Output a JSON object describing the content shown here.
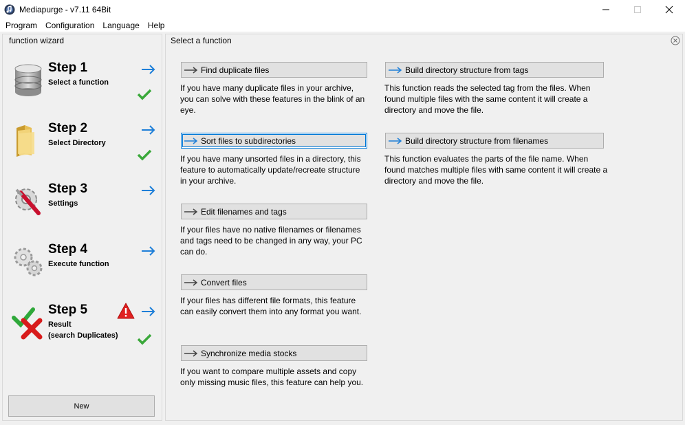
{
  "window": {
    "title": "Mediapurge - v7.11 64Bit",
    "controls": [
      "minimize",
      "maximize",
      "close"
    ]
  },
  "menu": [
    "Program",
    "Configuration",
    "Language",
    "Help"
  ],
  "wizard": {
    "caption": "function wizard",
    "steps": [
      {
        "title": "Step 1",
        "subtitle": "Select a function",
        "icon": "database-icon",
        "done": true
      },
      {
        "title": "Step 2",
        "subtitle": "Select Directory",
        "icon": "folder-icon",
        "done": true
      },
      {
        "title": "Step 3",
        "subtitle": "Settings",
        "icon": "settings-tools-icon",
        "done": false
      },
      {
        "title": "Step 4",
        "subtitle": "Execute function",
        "icon": "gears-icon",
        "done": false
      },
      {
        "title": "Step 5",
        "subtitle": "Result\n(search Duplicates)",
        "icon": "result-icon",
        "done": true,
        "warning": true
      }
    ],
    "new_button": "New"
  },
  "main": {
    "caption": "Select a function",
    "functions": [
      {
        "label": "Find duplicate files",
        "desc": "If you have many duplicate files in your archive, you can solve with these features in the blink of an eye.",
        "active": false
      },
      {
        "label": "Sort files to subdirectories",
        "desc": "If you have many unsorted files in a directory, this feature to automatically update/recreate structure in your archive.",
        "active": true
      },
      {
        "label": "Edit filenames and tags",
        "desc": "If your files have no native filenames or filenames and tags need to be changed in any way, your PC can do.",
        "active": false
      },
      {
        "label": "Convert files",
        "desc": "If your files has different file formats, this feature can easily convert them into any format you want.",
        "active": false
      },
      {
        "label": "Synchronize media stocks",
        "desc": "If you want to compare multiple assets and copy only missing music files, this feature can help you.",
        "active": false
      },
      {
        "label": "Build directory structure from tags",
        "desc": "This function reads the selected tag from the files. When found multiple files with the same content it will create a directory and move the file.",
        "active": false
      },
      {
        "label": "Build directory structure from filenames",
        "desc": "This function evaluates the parts of the file name. When found matches multiple files with same content it will create a directory and move the file.",
        "active": false
      }
    ]
  },
  "colors": {
    "arrow_blue": "#1e7fd8",
    "check_green": "#3aa83a",
    "warning_red": "#e02020"
  }
}
